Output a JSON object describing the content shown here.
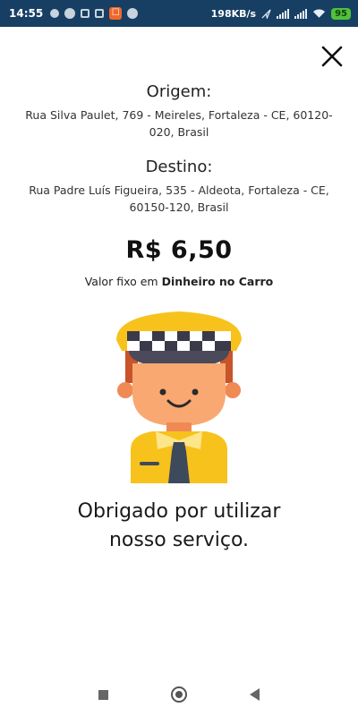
{
  "status_bar": {
    "time": "14:55",
    "speed": "198KB/s",
    "battery": "95"
  },
  "trip": {
    "origin_label": "Origem:",
    "origin_address": "Rua Silva Paulet, 769 - Meireles, Fortaleza - CE, 60120-020, Brasil",
    "destination_label": "Destino:",
    "destination_address": "Rua Padre Luís Figueira, 535 - Aldeota, Fortaleza - CE, 60150-120, Brasil"
  },
  "fare": {
    "price": "R$ 6,50",
    "note_prefix": "Valor fixo em",
    "payment_method": "Dinheiro no Carro"
  },
  "thanks": {
    "line1": "Obrigado por utilizar",
    "line2": "nosso serviço."
  },
  "icons": {
    "close": "close-icon",
    "driver": "taxi-driver-illustration"
  },
  "colors": {
    "status_bar": "#173f63",
    "hat_yellow": "#f7c21b",
    "skin": "#f9a872",
    "battery": "#4fc23a"
  }
}
